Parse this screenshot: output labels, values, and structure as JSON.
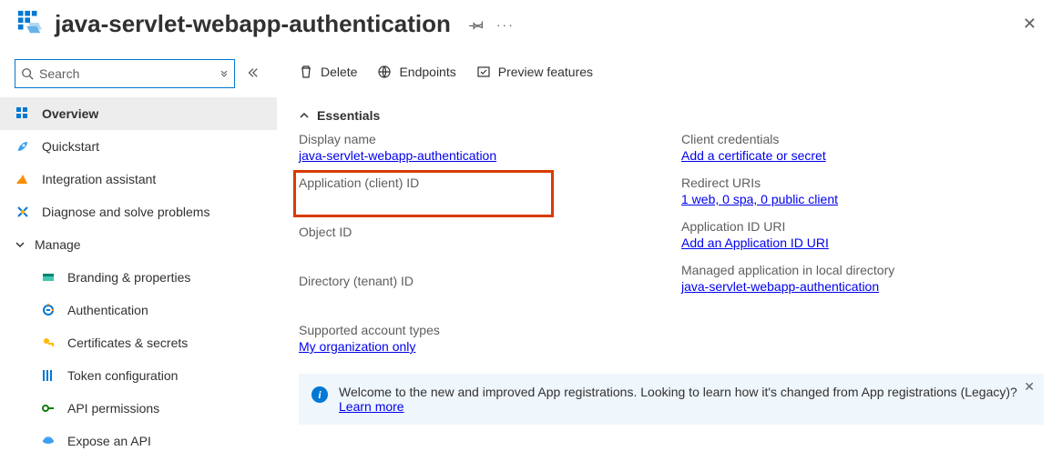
{
  "header": {
    "title": "java-servlet-webapp-authentication"
  },
  "search": {
    "placeholder": "Search"
  },
  "nav": {
    "overview": "Overview",
    "quickstart": "Quickstart",
    "integration": "Integration assistant",
    "diagnose": "Diagnose and solve problems",
    "manage": "Manage",
    "branding": "Branding & properties",
    "authentication": "Authentication",
    "certificates": "Certificates & secrets",
    "token": "Token configuration",
    "api_permissions": "API permissions",
    "expose_api": "Expose an API"
  },
  "toolbar": {
    "delete": "Delete",
    "endpoints": "Endpoints",
    "preview": "Preview features"
  },
  "essentials": {
    "heading": "Essentials",
    "display_name_label": "Display name",
    "display_name_value": "java-servlet-webapp-authentication",
    "client_id_label": "Application (client) ID",
    "object_id_label": "Object ID",
    "tenant_id_label": "Directory (tenant) ID",
    "account_types_label": "Supported account types",
    "account_types_value": "My organization only",
    "client_creds_label": "Client credentials",
    "client_creds_value": "Add a certificate or secret",
    "redirect_label": "Redirect URIs",
    "redirect_value": "1 web, 0 spa, 0 public client",
    "app_id_uri_label": "Application ID URI",
    "app_id_uri_value": "Add an Application ID URI",
    "managed_app_label": "Managed application in local directory",
    "managed_app_value": "java-servlet-webapp-authentication"
  },
  "banner": {
    "text": "Welcome to the new and improved App registrations. Looking to learn how it's changed from App registrations (Legacy)? ",
    "learn_more": "Learn more"
  }
}
